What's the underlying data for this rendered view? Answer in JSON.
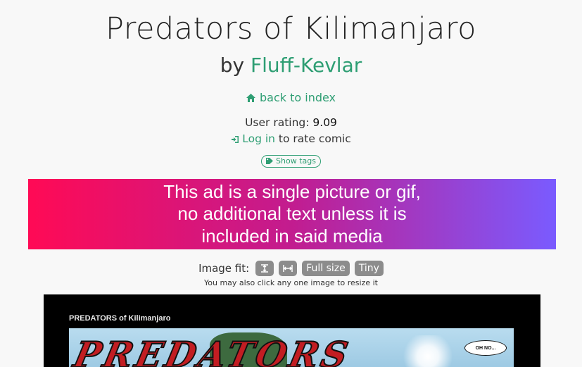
{
  "header": {
    "title": "Predators of Kilimanjaro",
    "by_prefix": "by",
    "author": "Fluff-Kevlar"
  },
  "nav": {
    "back_label": "back to index"
  },
  "rating": {
    "label": "User rating:",
    "value": "9.09"
  },
  "login": {
    "link_label": "Log in",
    "suffix": "to rate comic"
  },
  "tags": {
    "button_label": "Show tags"
  },
  "ad": {
    "text": "This ad is a single picture or gif,\nno additional text unless it is\nincluded in said media"
  },
  "image_fit": {
    "label": "Image fit:",
    "full_size_label": "Full size",
    "tiny_label": "Tiny",
    "hint": "You may also click any one image to resize it"
  },
  "comic_page": {
    "caption": "PREDATORS of Kilimanjaro",
    "logo_text": "PREDATORS",
    "speech_bubble": "OH NO..."
  },
  "colors": {
    "accent": "#2e9e73",
    "ad_gradient_start": "#ff0a55",
    "ad_gradient_end": "#7a5bff",
    "fit_button": "#8c8c8c"
  },
  "icons": {
    "back": "home-icon",
    "login": "sign-in-icon",
    "tags": "tag-icon",
    "fit_height": "fit-height-icon",
    "fit_width": "fit-width-icon"
  }
}
